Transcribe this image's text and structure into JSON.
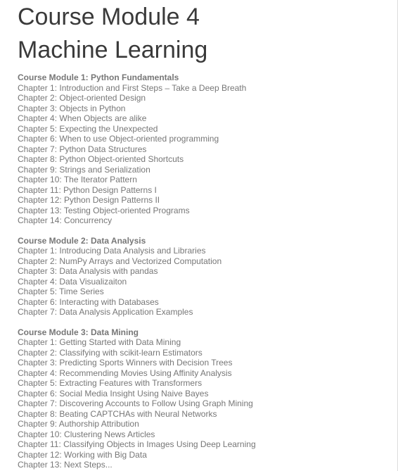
{
  "title": {
    "line1": "Course Module 4",
    "line2": "Machine Learning"
  },
  "modules": [
    {
      "heading": "Course Module 1: Python Fundamentals",
      "chapters": [
        "Chapter 1: Introduction and First Steps – Take a Deep Breath",
        "Chapter 2: Object-oriented Design",
        "Chapter 3: Objects in Python",
        "Chapter 4: When Objects are alike",
        "Chapter 5: Expecting the Unexpected",
        "Chapter 6: When to use Object-oriented programming",
        "Chapter 7: Python Data Structures",
        "Chapter 8: Python Object-oriented Shortcuts",
        "Chapter 9: Strings and Serialization",
        "Chapter 10: The Iterator Pattern",
        "Chapter 11: Python Design Patterns I",
        "Chapter 12: Python Design Patterns II",
        "Chapter 13: Testing Object-oriented Programs",
        "Chapter 14: Concurrency"
      ]
    },
    {
      "heading": "Course Module 2: Data Analysis",
      "chapters": [
        "Chapter 1: Introducing Data Analysis and Libraries",
        "Chapter 2: NumPy Arrays and Vectorized Computation",
        "Chapter 3: Data Analysis with pandas",
        "Chapter 4: Data Visualizaiton",
        "Chapter 5: Time Series",
        "Chapter 6: Interacting with Databases",
        "Chapter 7: Data Analysis Application Examples"
      ]
    },
    {
      "heading": "Course Module 3: Data Mining",
      "chapters": [
        "Chapter 1: Getting Started with Data Mining",
        "Chapter 2: Classifying with scikit-learn Estimators",
        "Chapter 3: Predicting Sports Winners with Decision Trees",
        "Chapter 4: Recommending Movies Using Affinity Analysis",
        "Chapter 5: Extracting Features with Transformers",
        "Chapter 6: Social Media Insight Using Naive Bayes",
        "Chapter 7: Discovering Accounts to Follow Using Graph Mining",
        "Chapter 8: Beating CAPTCHAs with Neural Networks",
        "Chapter 9: Authorship Attribution",
        "Chapter 10: Clustering News Articles",
        "Chapter 11: Classifying Objects in Images Using Deep Learning",
        "Chapter 12: Working with Big Data",
        "Chapter 13: Next Steps..."
      ]
    }
  ]
}
